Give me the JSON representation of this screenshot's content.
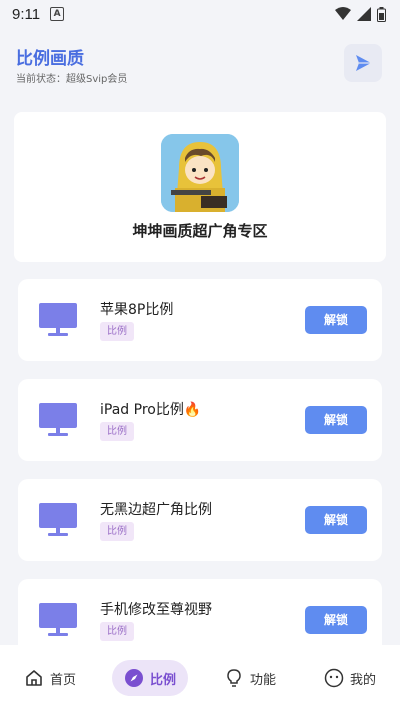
{
  "status_bar": {
    "time": "9:11",
    "app_badge": "A"
  },
  "header": {
    "title": "比例画质",
    "status_text": "当前状态：超级Svip会员"
  },
  "hero": {
    "title": "坤坤画质超广角专区"
  },
  "ratios": [
    {
      "name": "苹果8P比例",
      "tag": "比例",
      "button": "解锁"
    },
    {
      "name": "iPad Pro比例🔥",
      "tag": "比例",
      "button": "解锁"
    },
    {
      "name": "无黑边超广角比例",
      "tag": "比例",
      "button": "解锁"
    },
    {
      "name": "手机修改至尊视野",
      "tag": "比例",
      "button": "解锁"
    }
  ],
  "nav": [
    {
      "label": "首页",
      "icon": "home-icon"
    },
    {
      "label": "比例",
      "icon": "compass-icon",
      "active": true
    },
    {
      "label": "功能",
      "icon": "bulb-icon"
    },
    {
      "label": "我的",
      "icon": "face-icon"
    }
  ],
  "colors": {
    "accent": "#5f8cf0",
    "title": "#4a6ee0",
    "monitor": "#7b7fe8",
    "tag_bg": "#f1e6f8",
    "active_nav": "#ece4f8"
  }
}
